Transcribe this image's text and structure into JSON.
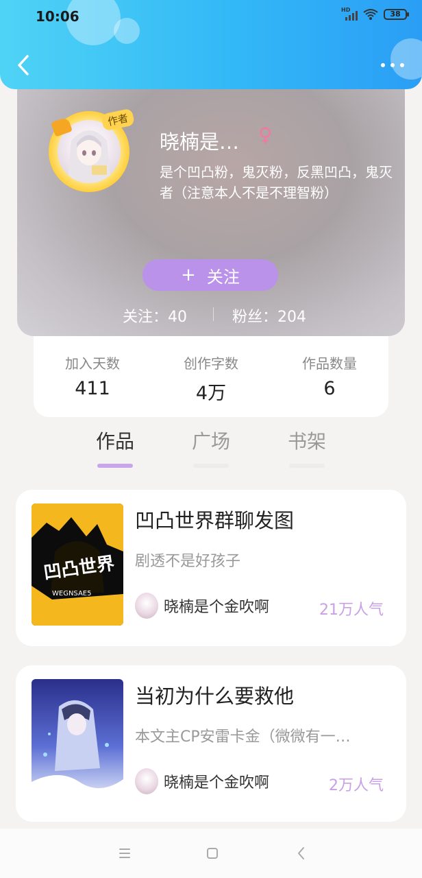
{
  "status_bar": {
    "time": "10:06",
    "signal_label": "HD",
    "battery": "38"
  },
  "header": {
    "back_icon": "chevron-left-icon",
    "more_icon": "more-horizontal-icon"
  },
  "profile": {
    "author_tag": "作者",
    "username": "晓楠是…",
    "gender_symbol": "♀",
    "bio": "是个凹凸粉，鬼灭粉，反黑凹凸，鬼灭者（注意本人不是不理智粉）",
    "follow_plus": "+",
    "follow_label": "关注",
    "following": "关注：40",
    "fans": "粉丝：204"
  },
  "stats": [
    {
      "label": "加入天数",
      "value": "411"
    },
    {
      "label": "创作字数",
      "value": "4万"
    },
    {
      "label": "作品数量",
      "value": "6"
    }
  ],
  "tabs": [
    {
      "label": "作品",
      "active": true
    },
    {
      "label": "广场",
      "active": false
    },
    {
      "label": "书架",
      "active": false
    }
  ],
  "works": [
    {
      "title": "凹凸世界群聊发图",
      "description": "剧透不是好孩子",
      "author": "晓楠是个金吹啊",
      "popularity": "21万人气"
    },
    {
      "title": "当初为什么要救他",
      "description": "本文主CP安雷卡金（微微有一…",
      "author": "晓楠是个金吹啊",
      "popularity": "2万人气"
    }
  ],
  "colors": {
    "header_start": "#4fd3f5",
    "header_end": "#2a9ef5",
    "follow_button": "#bb92ea",
    "popularity": "#c9a0e6",
    "gender": "#f07aa0",
    "tab_active_indicator": "#c7a6ea"
  }
}
